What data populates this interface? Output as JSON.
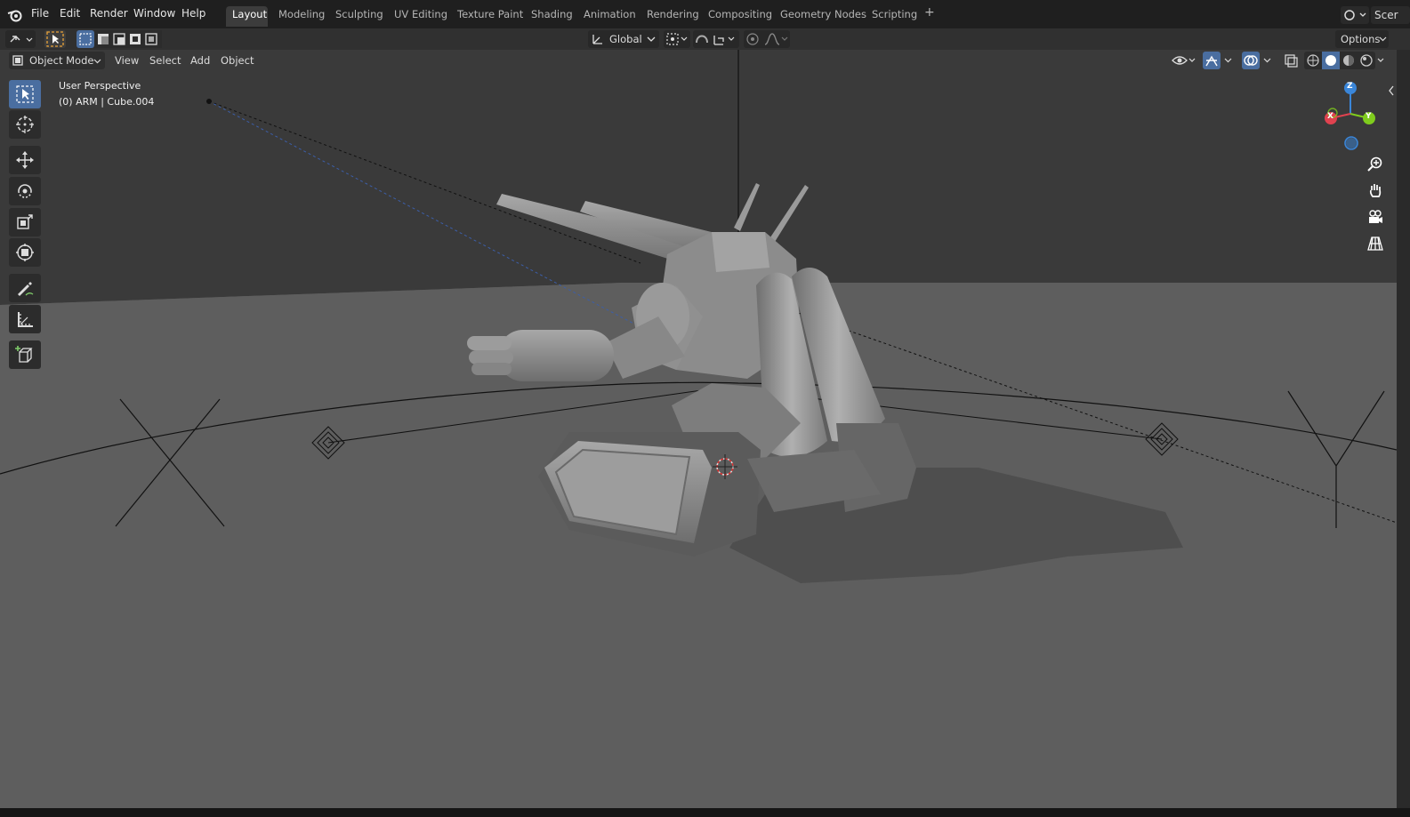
{
  "menu": {
    "file": "File",
    "edit": "Edit",
    "render": "Render",
    "window": "Window",
    "help": "Help"
  },
  "workspaces": [
    "Layout",
    "Modeling",
    "Sculpting",
    "UV Editing",
    "Texture Paint",
    "Shading",
    "Animation",
    "Rendering",
    "Compositing",
    "Geometry Nodes",
    "Scripting"
  ],
  "add_tab": "+",
  "scene_label": "Scer",
  "transform": {
    "orientation": "Global"
  },
  "options_label": "Options",
  "viewport_header": {
    "mode": "Object Mode",
    "view": "View",
    "select": "Select",
    "add": "Add",
    "object": "Object"
  },
  "overlay": {
    "view_name": "User Perspective",
    "object_info": "(0) ARM | Cube.004"
  },
  "gizmo": {
    "x": "X",
    "y": "Y",
    "z": "Z"
  },
  "colors": {
    "accent": "#4a6ea0",
    "axis_x": "#e0424f",
    "axis_y": "#7fcc1d",
    "axis_z": "#3a86d9",
    "viewport_bg": "#5a5a5a"
  },
  "tools": [
    "select-box-icon",
    "cursor-icon",
    "move-icon",
    "rotate-icon",
    "scale-icon",
    "transform-icon",
    "annotate-icon",
    "measure-icon",
    "add-cube-icon"
  ]
}
